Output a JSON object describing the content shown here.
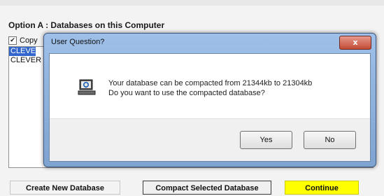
{
  "window": {
    "section_title": "Option A : Databases on this Computer",
    "copy_checkbox": {
      "label": "Copy",
      "checked": true
    },
    "databases": [
      {
        "label": "CLEVER",
        "selected": true
      },
      {
        "label": "CLEVER",
        "selected": false
      }
    ],
    "buttons": {
      "create": "Create New Database",
      "compact": "Compact Selected Database",
      "continue": "Continue"
    }
  },
  "dialog": {
    "title": "User Question?",
    "icon": "computer-question-icon",
    "message_line1": "Your database can be compacted from 21344kb to 21304kb",
    "message_line2": "Do you want to use the compacted database?",
    "close_label": "x",
    "yes_label": "Yes",
    "no_label": "No"
  },
  "colors": {
    "continue_button": "#ffff00",
    "selection": "#3366cc",
    "dialog_frame": "#9ec0e8",
    "close_button": "#c24a37"
  }
}
